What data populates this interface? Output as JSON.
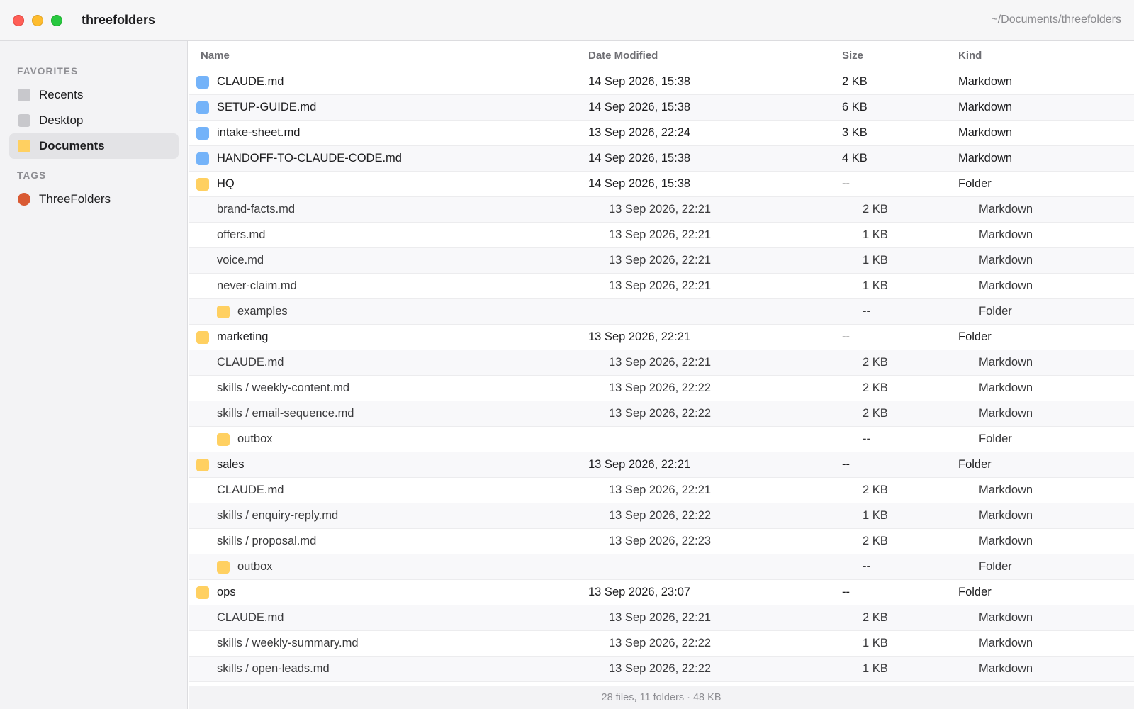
{
  "window": {
    "title": "threefolders",
    "path": "~/Documents/threefolders"
  },
  "sidebar": {
    "favorites_label": "FAVORITES",
    "favorites": [
      {
        "label": "Recents",
        "icon": "recents-icon"
      },
      {
        "label": "Desktop",
        "icon": "desktop-icon"
      },
      {
        "label": "Documents",
        "icon": "folder-icon",
        "active": true
      }
    ],
    "tags_label": "TAGS",
    "tags": [
      {
        "label": "ThreeFolders",
        "color": "#d95a33"
      }
    ]
  },
  "columns": {
    "name": "Name",
    "date": "Date Modified",
    "size": "Size",
    "kind": "Kind"
  },
  "rows": [
    {
      "name": "CLAUDE.md",
      "date": "14 Sep 2026, 15:38",
      "size": "2 KB",
      "kind": "Markdown",
      "type": "md",
      "level": 0
    },
    {
      "name": "SETUP-GUIDE.md",
      "date": "14 Sep 2026, 15:38",
      "size": "6 KB",
      "kind": "Markdown",
      "type": "md",
      "level": 0
    },
    {
      "name": "intake-sheet.md",
      "date": "13 Sep 2026, 22:24",
      "size": "3 KB",
      "kind": "Markdown",
      "type": "md",
      "level": 0
    },
    {
      "name": "HANDOFF-TO-CLAUDE-CODE.md",
      "date": "14 Sep 2026, 15:38",
      "size": "4 KB",
      "kind": "Markdown",
      "type": "md",
      "level": 0
    },
    {
      "name": "HQ",
      "date": "14 Sep 2026, 15:38",
      "size": "--",
      "kind": "Folder",
      "type": "folder",
      "level": 0
    },
    {
      "name": "brand-facts.md",
      "date": "13 Sep 2026, 22:21",
      "size": "2 KB",
      "kind": "Markdown",
      "type": "file",
      "level": 1
    },
    {
      "name": "offers.md",
      "date": "13 Sep 2026, 22:21",
      "size": "1 KB",
      "kind": "Markdown",
      "type": "file",
      "level": 1
    },
    {
      "name": "voice.md",
      "date": "13 Sep 2026, 22:21",
      "size": "1 KB",
      "kind": "Markdown",
      "type": "file",
      "level": 1
    },
    {
      "name": "never-claim.md",
      "date": "13 Sep 2026, 22:21",
      "size": "1 KB",
      "kind": "Markdown",
      "type": "file",
      "level": 1
    },
    {
      "name": "examples",
      "date": "",
      "size": "--",
      "kind": "Folder",
      "type": "folder",
      "level": 1
    },
    {
      "name": "marketing",
      "date": "13 Sep 2026, 22:21",
      "size": "--",
      "kind": "Folder",
      "type": "folder",
      "level": 0
    },
    {
      "name": "CLAUDE.md",
      "date": "13 Sep 2026, 22:21",
      "size": "2 KB",
      "kind": "Markdown",
      "type": "file",
      "level": 1
    },
    {
      "name": "skills / weekly-content.md",
      "date": "13 Sep 2026, 22:22",
      "size": "2 KB",
      "kind": "Markdown",
      "type": "file",
      "level": 1
    },
    {
      "name": "skills / email-sequence.md",
      "date": "13 Sep 2026, 22:22",
      "size": "2 KB",
      "kind": "Markdown",
      "type": "file",
      "level": 1
    },
    {
      "name": "outbox",
      "date": "",
      "size": "--",
      "kind": "Folder",
      "type": "folder",
      "level": 1
    },
    {
      "name": "sales",
      "date": "13 Sep 2026, 22:21",
      "size": "--",
      "kind": "Folder",
      "type": "folder",
      "level": 0
    },
    {
      "name": "CLAUDE.md",
      "date": "13 Sep 2026, 22:21",
      "size": "2 KB",
      "kind": "Markdown",
      "type": "file",
      "level": 1
    },
    {
      "name": "skills / enquiry-reply.md",
      "date": "13 Sep 2026, 22:22",
      "size": "1 KB",
      "kind": "Markdown",
      "type": "file",
      "level": 1
    },
    {
      "name": "skills / proposal.md",
      "date": "13 Sep 2026, 22:23",
      "size": "2 KB",
      "kind": "Markdown",
      "type": "file",
      "level": 1
    },
    {
      "name": "outbox",
      "date": "",
      "size": "--",
      "kind": "Folder",
      "type": "folder",
      "level": 1
    },
    {
      "name": "ops",
      "date": "13 Sep 2026, 23:07",
      "size": "--",
      "kind": "Folder",
      "type": "folder",
      "level": 0
    },
    {
      "name": "CLAUDE.md",
      "date": "13 Sep 2026, 22:21",
      "size": "2 KB",
      "kind": "Markdown",
      "type": "file",
      "level": 1
    },
    {
      "name": "skills / weekly-summary.md",
      "date": "13 Sep 2026, 22:22",
      "size": "1 KB",
      "kind": "Markdown",
      "type": "file",
      "level": 1
    },
    {
      "name": "skills / open-leads.md",
      "date": "13 Sep 2026, 22:22",
      "size": "1 KB",
      "kind": "Markdown",
      "type": "file",
      "level": 1
    }
  ],
  "footer": {
    "status": "28 files, 11 folders · 48 KB"
  },
  "colors": {
    "markdown_icon": "#74b3f9",
    "folder_icon": "#ffd061",
    "tag_threefolders": "#d95a33"
  }
}
